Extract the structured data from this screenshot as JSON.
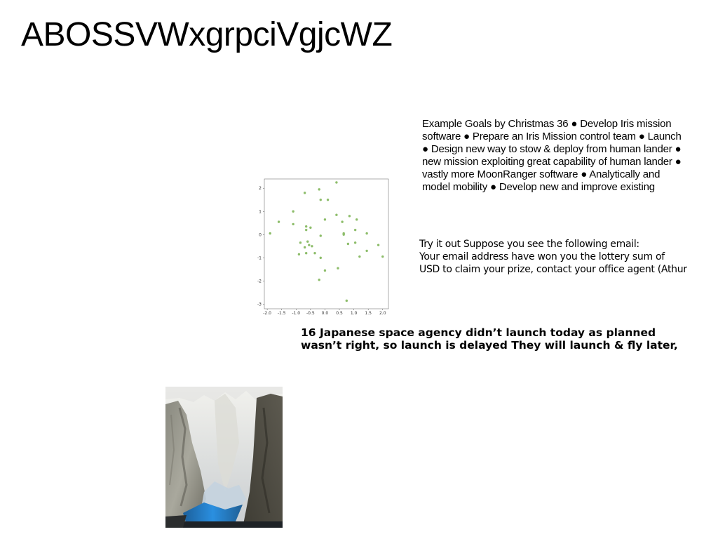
{
  "title": "ABOSSVWxgrpciVgjcWZ",
  "goals": {
    "lines": [
      "Example Goals by Christmas 36 ● Develop Iris mission",
      "software ● Prepare an Iris Mission control team ● Launch",
      "● Design new way to stow & deploy from human lander ●",
      "new mission exploiting great capability of human lander ●",
      "vastly more MoonRanger software ● Analytically and",
      "model mobility ● Develop new and improve existing"
    ]
  },
  "email": {
    "lines": [
      "Try it out Suppose you see the following email:",
      "Your email address have won you the lottery sum of",
      "USD to claim your prize, contact your office agent (Athur"
    ]
  },
  "news": {
    "lines": [
      "16 Japanese space agency didn’t launch today as planned",
      "wasn’t right, so launch is delayed They will launch & fly later,"
    ]
  },
  "chart_data": {
    "type": "scatter",
    "title": "",
    "xlabel": "",
    "ylabel": "",
    "xlim": [
      -2.1,
      2.2
    ],
    "ylim": [
      -3.2,
      2.4
    ],
    "xticks": [
      "-2.0",
      "-1.5",
      "-1.0",
      "-0.5",
      "0.0",
      "0.5",
      "1.0",
      "1.5",
      "2.0"
    ],
    "yticks": [
      "2",
      "1",
      "0",
      "-1",
      "-2",
      "-3"
    ],
    "grid": false,
    "color": "#8dbd6a",
    "points": [
      [
        0.4,
        2.25
      ],
      [
        -0.2,
        1.95
      ],
      [
        -0.7,
        1.8
      ],
      [
        -0.15,
        1.5
      ],
      [
        0.1,
        1.5
      ],
      [
        -1.1,
        1.0
      ],
      [
        -1.6,
        0.55
      ],
      [
        -1.1,
        0.45
      ],
      [
        0.4,
        0.85
      ],
      [
        0.85,
        0.8
      ],
      [
        1.1,
        0.65
      ],
      [
        0.6,
        0.55
      ],
      [
        0.0,
        0.65
      ],
      [
        -0.65,
        0.35
      ],
      [
        -0.5,
        0.3
      ],
      [
        -0.65,
        0.2
      ],
      [
        1.05,
        0.2
      ],
      [
        -1.9,
        0.05
      ],
      [
        0.65,
        0.05
      ],
      [
        0.65,
        0.0
      ],
      [
        1.45,
        0.05
      ],
      [
        -0.15,
        -0.05
      ],
      [
        -0.85,
        -0.35
      ],
      [
        -0.6,
        -0.3
      ],
      [
        -0.55,
        -0.45
      ],
      [
        -0.7,
        -0.55
      ],
      [
        -0.45,
        -0.5
      ],
      [
        0.8,
        -0.4
      ],
      [
        1.05,
        -0.35
      ],
      [
        1.85,
        -0.45
      ],
      [
        -0.65,
        -0.8
      ],
      [
        -0.35,
        -0.8
      ],
      [
        -0.9,
        -0.85
      ],
      [
        1.45,
        -0.7
      ],
      [
        -0.15,
        -1.0
      ],
      [
        1.2,
        -0.95
      ],
      [
        2.0,
        -0.95
      ],
      [
        0.45,
        -1.45
      ],
      [
        0.0,
        -1.55
      ],
      [
        -0.2,
        -1.95
      ],
      [
        0.75,
        -2.85
      ]
    ]
  },
  "photo": {
    "description_icon": "mountain-photo"
  }
}
